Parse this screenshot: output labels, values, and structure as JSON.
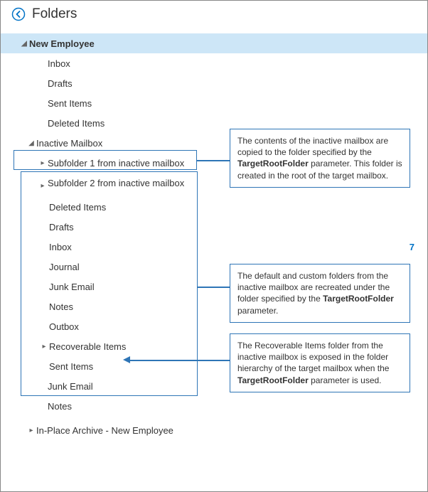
{
  "header": {
    "title": "Folders"
  },
  "tree": {
    "root_label": "New Employee",
    "root_children": [
      "Inbox",
      "Drafts",
      "Sent Items",
      "Deleted Items"
    ],
    "inactive_label": "Inactive Mailbox",
    "inactive_sub": {
      "sub1": "Subfolder 1 from inactive mailbox",
      "sub2": "Subfolder 2 from inactive mailbox",
      "folders": [
        "Deleted Items",
        "Drafts",
        "Inbox",
        "Journal",
        "Junk Email",
        "Notes",
        "Outbox",
        "Recoverable Items",
        "Sent Items"
      ],
      "inbox_count": "7"
    },
    "after": [
      "Junk Email",
      "Notes"
    ],
    "archive": "In-Place Archive - New Employee"
  },
  "annotations": {
    "a1_pre": "The contents of the inactive mailbox are copied to the folder specified by the ",
    "a1_bold": "TargetRootFolder",
    "a1_post": " parameter. This folder is created in the root of the target mailbox.",
    "a2_pre": "The default and custom folders from the inactive mailbox are recreated under the folder specified by the ",
    "a2_bold": "TargetRootFolder",
    "a2_post": " parameter.",
    "a3_pre": "The Recoverable Items folder from the inactive mailbox is exposed in the folder hierarchy of the target mailbox when the ",
    "a3_bold": "TargetRootFolder",
    "a3_post": " parameter is used."
  }
}
